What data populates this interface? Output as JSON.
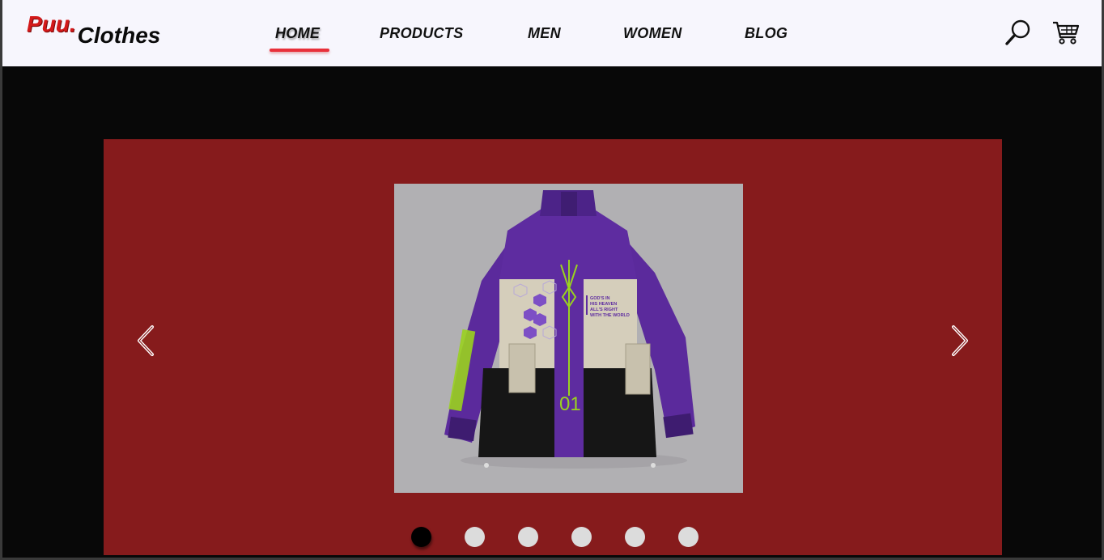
{
  "logo": {
    "part1": "Puu.",
    "part2": "Clothes"
  },
  "nav": {
    "items": [
      {
        "label": "HOME",
        "active": true
      },
      {
        "label": "PRODUCTS",
        "active": false
      },
      {
        "label": "MEN",
        "active": false
      },
      {
        "label": "WOMEN",
        "active": false
      },
      {
        "label": "BLOG",
        "active": false
      }
    ]
  },
  "header_icons": [
    "search-icon",
    "cart-icon"
  ],
  "slider": {
    "background_color": "#861b1c",
    "product": "purple-techwear-jacket",
    "jacket_print_text": [
      "GOD'S IN",
      "HIS HEAVEN",
      "ALL'S RIGHT",
      "WITH THE WORLD"
    ],
    "jacket_number": "01",
    "dots": {
      "count": 6,
      "active_index": 0
    }
  },
  "colors": {
    "accent": "#e8303a",
    "brand_red": "#d3191a",
    "navbar_bg": "#f7f6fd"
  }
}
